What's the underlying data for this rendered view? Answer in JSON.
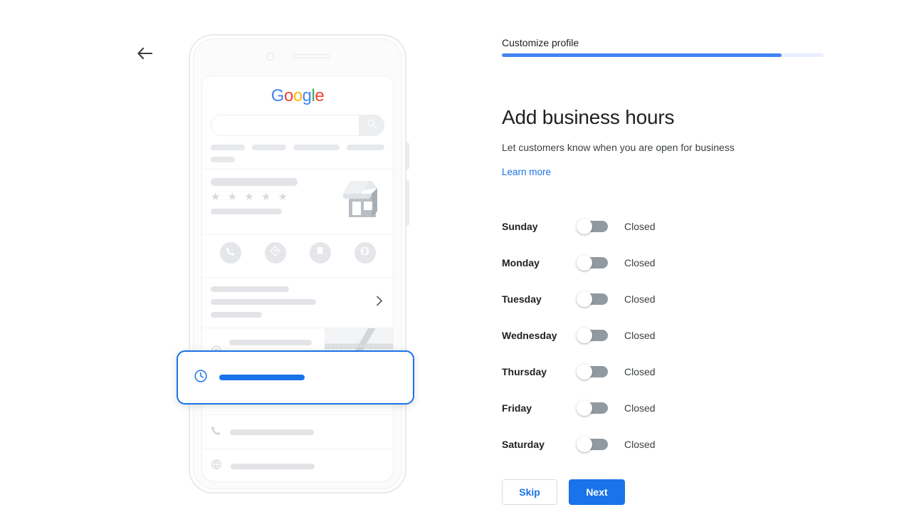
{
  "nav": {
    "back_icon": "arrow-left-icon"
  },
  "panel": {
    "step_label": "Customize profile",
    "progress_percent": 87,
    "title": "Add business hours",
    "subtitle": "Let customers know when you are open for business",
    "learn_more": "Learn more",
    "accent_color": "#1a73e8",
    "progress_color": "#4285f4",
    "progress_track_color": "#e8f0fe"
  },
  "hours": {
    "days": [
      {
        "name": "Sunday",
        "status": "Closed",
        "enabled": false
      },
      {
        "name": "Monday",
        "status": "Closed",
        "enabled": false
      },
      {
        "name": "Tuesday",
        "status": "Closed",
        "enabled": false
      },
      {
        "name": "Wednesday",
        "status": "Closed",
        "enabled": false
      },
      {
        "name": "Thursday",
        "status": "Closed",
        "enabled": false
      },
      {
        "name": "Friday",
        "status": "Closed",
        "enabled": false
      },
      {
        "name": "Saturday",
        "status": "Closed",
        "enabled": false
      }
    ]
  },
  "actions": {
    "skip_label": "Skip",
    "next_label": "Next"
  },
  "preview": {
    "logo": {
      "letters": [
        {
          "char": "G",
          "color": "#4285f4"
        },
        {
          "char": "o",
          "color": "#ea4335"
        },
        {
          "char": "o",
          "color": "#fbbc05"
        },
        {
          "char": "g",
          "color": "#4285f4"
        },
        {
          "char": "l",
          "color": "#34a853"
        },
        {
          "char": "e",
          "color": "#ea4335"
        }
      ]
    },
    "search_icon": "search-icon",
    "stars": "★ ★ ★ ★ ★",
    "action_icons": [
      "phone-icon",
      "directions-icon",
      "bookmark-icon",
      "globe-icon"
    ],
    "hours_card": {
      "icon": "clock-icon",
      "highlight_color": "#1a73e8"
    },
    "address_icon": "location-pin-icon",
    "map_pin_icon": "map-pin-icon",
    "phone_row_icon": "phone-icon",
    "website_row_icon": "globe-icon",
    "chevron_icon": "chevron-right-icon"
  }
}
